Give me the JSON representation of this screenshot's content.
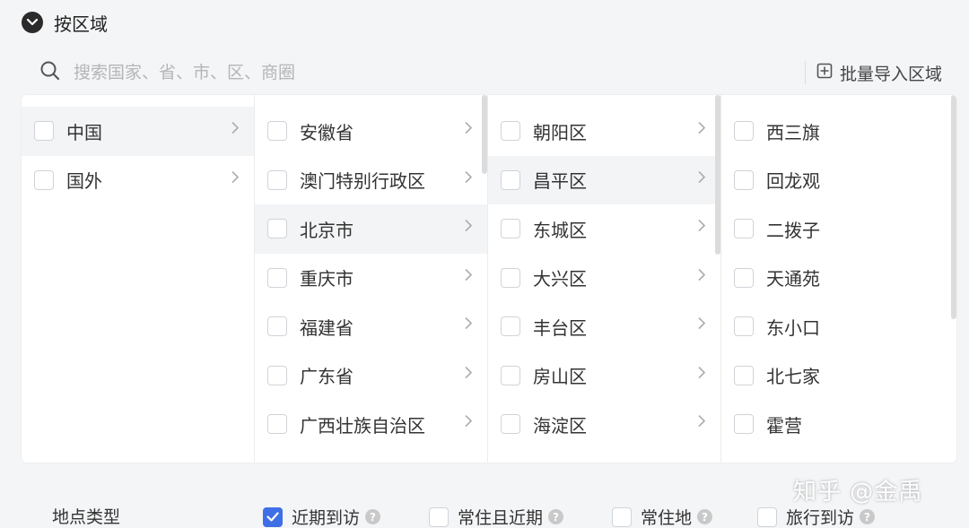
{
  "header": {
    "title": "按区域",
    "collapse_icon": "chevron-down-circle-icon"
  },
  "search": {
    "placeholder": "搜索国家、省、市、区、商圈",
    "icon": "search-icon"
  },
  "import_button": {
    "label": "批量导入区域",
    "icon": "import-icon"
  },
  "columns": [
    {
      "items": [
        {
          "label": "中国",
          "active": true
        },
        {
          "label": "国外",
          "active": false
        }
      ]
    },
    {
      "items": [
        {
          "label": "安徽省",
          "active": false
        },
        {
          "label": "澳门特别行政区",
          "active": false
        },
        {
          "label": "北京市",
          "active": true
        },
        {
          "label": "重庆市",
          "active": false
        },
        {
          "label": "福建省",
          "active": false
        },
        {
          "label": "广东省",
          "active": false
        },
        {
          "label": "广西壮族自治区",
          "active": false
        }
      ]
    },
    {
      "items": [
        {
          "label": "朝阳区",
          "active": false
        },
        {
          "label": "昌平区",
          "active": true
        },
        {
          "label": "东城区",
          "active": false
        },
        {
          "label": "大兴区",
          "active": false
        },
        {
          "label": "丰台区",
          "active": false
        },
        {
          "label": "房山区",
          "active": false
        },
        {
          "label": "海淀区",
          "active": false
        }
      ]
    },
    {
      "items": [
        {
          "label": "西三旗"
        },
        {
          "label": "回龙观"
        },
        {
          "label": "二拨子"
        },
        {
          "label": "天通苑"
        },
        {
          "label": "东小口"
        },
        {
          "label": "北七家"
        },
        {
          "label": "霍营"
        }
      ]
    }
  ],
  "footer": {
    "label": "地点类型",
    "options": [
      {
        "label": "近期到访",
        "checked": true
      },
      {
        "label": "常住且近期",
        "checked": false
      },
      {
        "label": "常住地",
        "checked": false
      },
      {
        "label": "旅行到访",
        "checked": false
      }
    ]
  },
  "watermark": "知乎 @金禹",
  "colors": {
    "accent": "#3f6fe6",
    "active_row": "#f3f4f6",
    "panel_bg": "#ffffff",
    "page_bg": "#f4f5f7"
  }
}
